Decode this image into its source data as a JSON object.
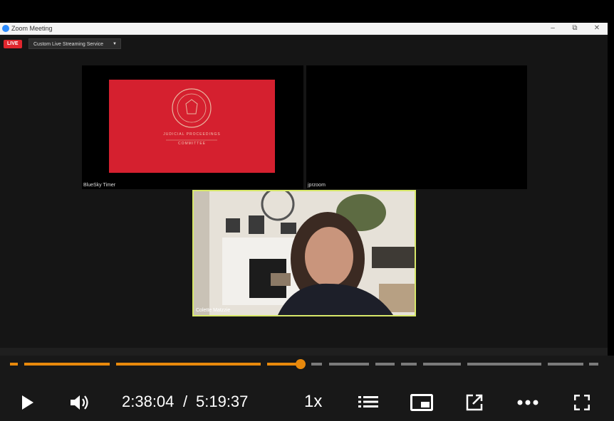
{
  "window": {
    "title": "Zoom Meeting",
    "controls": {
      "minimize": "–",
      "restore": "⧉",
      "close": "✕"
    }
  },
  "meeting": {
    "live_label": "LIVE",
    "stream_service": "Custom Live Streaming Service",
    "participants": [
      {
        "name": "BlueSky Timer"
      },
      {
        "name": "jprzoom"
      },
      {
        "name": "Colette Matzzie"
      }
    ],
    "slide_text": [
      "JUDICIAL PROCEEDINGS",
      "COMMITTEE"
    ],
    "slide_seal_text": "SENATE OF MARYLAND"
  },
  "player": {
    "current_time": "2:38:04",
    "separator": "/",
    "duration": "5:19:37",
    "speed": "1x",
    "progress": 0.495,
    "colors": {
      "played": "#e8890c",
      "unplayed": "#7a7a7a",
      "bar_bg": "#181818"
    }
  }
}
